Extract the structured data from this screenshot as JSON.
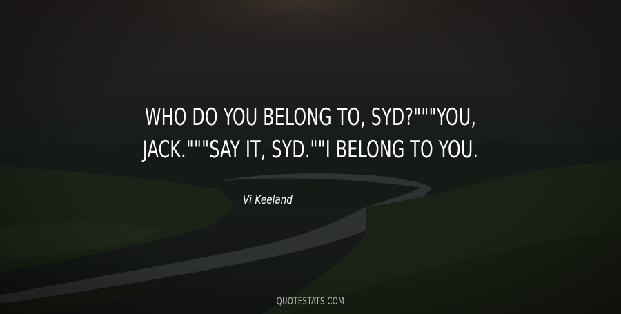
{
  "quote": {
    "line1": "WHO DO YOU BELONG TO, SYD?\"\"\"YOU,",
    "line2": "JACK.\"\"\"SAY IT, SYD.\"\"I BELONG TO YOU."
  },
  "author": "Vi Keeland",
  "watermark": "QUOTESTATS.COM",
  "colors": {
    "text": "#ffffff",
    "background_dark": "#1f2322"
  }
}
